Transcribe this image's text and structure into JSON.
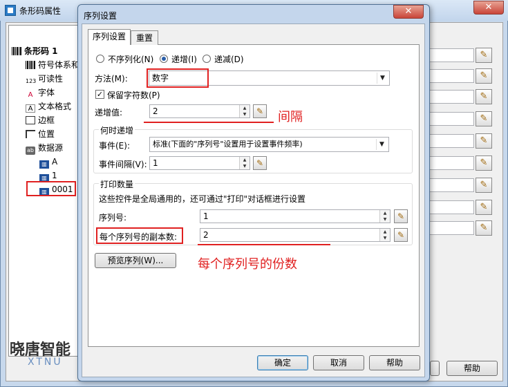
{
  "background_window": {
    "title": "条形码属性",
    "close_glyph": "✕",
    "help_button": "帮助"
  },
  "tree": {
    "root": "条形码 1",
    "items": [
      "符号体系和",
      "可读性",
      "字体",
      "文本格式",
      "边框",
      "位置",
      "数据源"
    ],
    "sources": [
      "A",
      "1",
      "0001"
    ]
  },
  "dialog": {
    "title": "序列设置",
    "close_glyph": "✕",
    "tabs": [
      "序列设置",
      "重置"
    ],
    "radios": [
      {
        "label": "不序列化(N)",
        "selected": false
      },
      {
        "label": "递增(I)",
        "selected": true
      },
      {
        "label": "递减(D)",
        "selected": false
      }
    ],
    "method": {
      "label": "方法(M):",
      "value": "数字"
    },
    "keep_chars": {
      "label": "保留字符数(P)",
      "checked": true
    },
    "increment": {
      "label": "递增值:",
      "value": "2"
    },
    "when_group": {
      "title": "何时递增",
      "event_label": "事件(E):",
      "event_value": "标准(下面的\"序列号\"设置用于设置事件频率)",
      "interval_label": "事件间隔(V):",
      "interval_value": "1"
    },
    "print_group": {
      "title": "打印数量",
      "note": "这些控件是全局通用的，还可通过\"打印\"对话框进行设置",
      "serial_label": "序列号:",
      "serial_value": "1",
      "copies_label": "每个序列号的副本数:",
      "copies_value": "2"
    },
    "preview_button": "预览序列(W)...",
    "ok": "确定",
    "cancel": "取消",
    "help": "帮助"
  },
  "annotations": {
    "interval": "间隔",
    "copies": "每个序列号的份数"
  },
  "watermark": {
    "cn": "晓唐智能",
    "en": "XTNU"
  },
  "colors": {
    "annotation": "#e02020",
    "titlebar": "#c4d6ec"
  }
}
